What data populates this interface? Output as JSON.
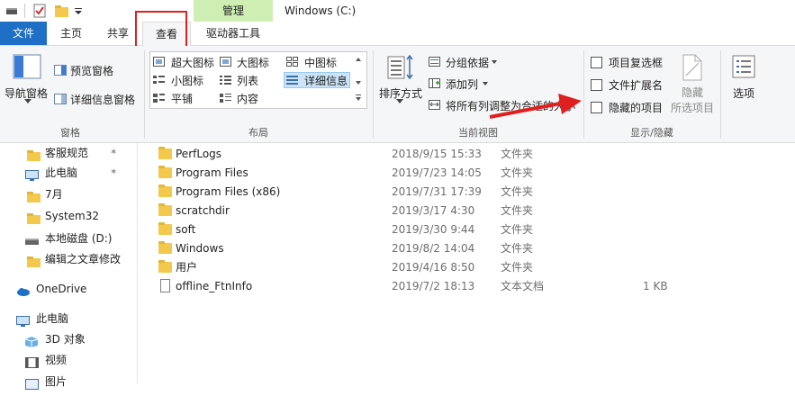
{
  "titlebar": {
    "manage_tab": "管理",
    "title": "Windows (C:)"
  },
  "tabs": {
    "file": "文件",
    "home": "主页",
    "share": "共享",
    "view": "查看",
    "drive_tools": "驱动器工具"
  },
  "ribbon": {
    "pane": {
      "nav_pane": "导航窗格",
      "preview_pane": "预览窗格",
      "details_pane": "详细信息窗格",
      "group": "窗格"
    },
    "layout": {
      "extra_large": "超大图标",
      "large": "大图标",
      "medium": "中图标",
      "small": "小图标",
      "list": "列表",
      "details": "详细信息",
      "tiles": "平铺",
      "content": "内容",
      "group": "布局"
    },
    "current_view": {
      "sort_by": "排序方式",
      "group_by": "分组依据",
      "add_columns": "添加列",
      "size_all": "将所有列调整为合适的大小",
      "group": "当前视图"
    },
    "show_hide": {
      "item_checkboxes": "项目复选框",
      "file_extensions": "文件扩展名",
      "hidden_items": "隐藏的项目",
      "hide_selected_line1": "隐藏",
      "hide_selected_line2": "所选项目",
      "group": "显示/隐藏"
    },
    "options": "选项"
  },
  "nav": [
    {
      "label": "客服规范",
      "icon": "folder-icon"
    },
    {
      "label": "此电脑",
      "icon": "computer-icon"
    },
    {
      "label": "7月",
      "icon": "folder-icon"
    },
    {
      "label": "System32",
      "icon": "folder-icon"
    },
    {
      "label": "本地磁盘 (D:)",
      "icon": "drive-icon"
    },
    {
      "label": "编辑之文章修改",
      "icon": "folder-icon"
    },
    {
      "label": "OneDrive",
      "icon": "cloud-icon"
    },
    {
      "label": "此电脑",
      "icon": "computer-icon"
    },
    {
      "label": "3D 对象",
      "icon": "cube-icon"
    },
    {
      "label": "视频",
      "icon": "video-icon"
    },
    {
      "label": "图片",
      "icon": "picture-icon"
    }
  ],
  "files": [
    {
      "name": "PerfLogs",
      "date": "2018/9/15 15:33",
      "type": "文件夹",
      "size": ""
    },
    {
      "name": "Program Files",
      "date": "2019/7/23 14:05",
      "type": "文件夹",
      "size": ""
    },
    {
      "name": "Program Files (x86)",
      "date": "2019/7/31 17:39",
      "type": "文件夹",
      "size": ""
    },
    {
      "name": "scratchdir",
      "date": "2019/3/17 4:30",
      "type": "文件夹",
      "size": ""
    },
    {
      "name": "soft",
      "date": "2019/3/30 9:44",
      "type": "文件夹",
      "size": ""
    },
    {
      "name": "Windows",
      "date": "2019/8/2 14:04",
      "type": "文件夹",
      "size": ""
    },
    {
      "name": "用户",
      "date": "2019/4/16 8:50",
      "type": "文件夹",
      "size": ""
    },
    {
      "name": "offline_FtnInfo",
      "date": "2019/7/2 18:13",
      "type": "文本文档",
      "size": "1 KB"
    }
  ],
  "colors": {
    "file_tab": "#1e6fc6",
    "manage_tab": "#cfeeb4",
    "highlight_red": "#e02020",
    "folder": "#f2c94c"
  }
}
